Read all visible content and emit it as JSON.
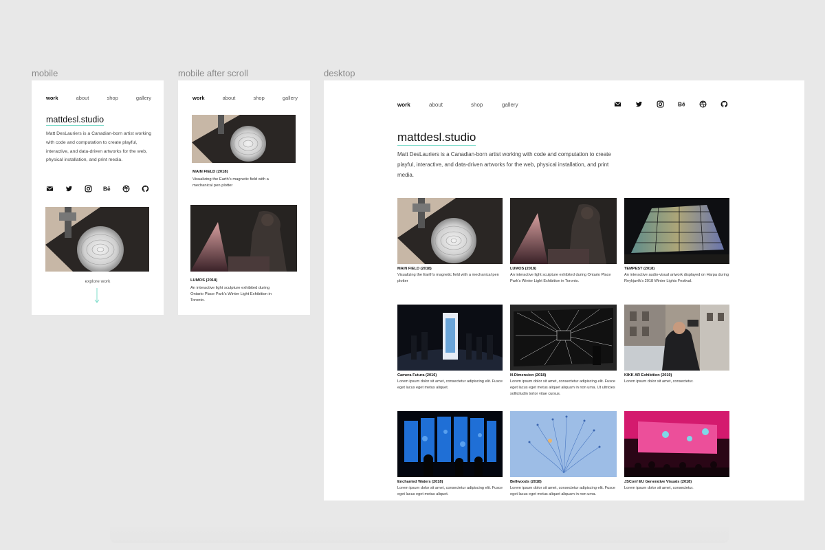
{
  "captions": {
    "mobile": "mobile",
    "mobile_scroll": "mobile after scroll",
    "desktop": "desktop"
  },
  "nav": {
    "work": "work",
    "about": "about",
    "shop": "shop",
    "gallery": "gallery"
  },
  "site": {
    "title": "mattdesl.studio",
    "bio": "Matt DesLauriers is a Canadian-born artist working with code and computation to create playful, interactive, and data-driven artworks for the web, physical installation, and print media.",
    "explore": "explore work"
  },
  "social_icons": [
    "mail-icon",
    "twitter-icon",
    "instagram-icon",
    "behance-icon",
    "dribbble-icon",
    "github-icon"
  ],
  "projects": [
    {
      "title": "MAIN FIELD (2018)",
      "desc": "Visualizing the Earth's magnetic field with a mechanical pen plotter"
    },
    {
      "title": "LUMOS (2018)",
      "desc": "An interactive light sculpture exhibited during Ontario Place Park's Winter Light Exhibition in Toronto."
    },
    {
      "title": "TEMPEST (2018)",
      "desc": "An interactive audio-visual artwork displayed on Harpa during Reykjavík's 2018 Winter Lights Festival."
    },
    {
      "title": "Camera Futura (2016)",
      "desc": "Lorem ipsum dolor sit amet, consectetur adipiscing elit. Fusce eget lacus eget metus aliquet."
    },
    {
      "title": "N-Dimension (2018)",
      "desc": "Lorem ipsum dolor sit amet, consectetur adipiscing elit. Fusce eget lacus eget metus aliquet aliquam in non urna. Ut ultricies sollicitudin tortor vitae cursus."
    },
    {
      "title": "KIKK AR Exhibition (2019)",
      "desc": "Lorem ipsum dolor sit amet, consectetur."
    },
    {
      "title": "Enchanted Waters (2018)",
      "desc": "Lorem ipsum dolor sit amet, consectetur adipiscing elit. Fusce eget lacus eget metus aliquet."
    },
    {
      "title": "Bellwoods (2018)",
      "desc": "Lorem ipsum dolor sit amet, consectetur adipiscing elit. Fusce eget lacus eget metus aliquet aliquam in non urna."
    },
    {
      "title": "JSConf EU Generative Visuals (2018)",
      "desc": "Lorem ipsum dolor sit amet, consectetur."
    }
  ],
  "colors": {
    "accent_underline": "#7fdccb",
    "background": "#e8e8e8"
  }
}
